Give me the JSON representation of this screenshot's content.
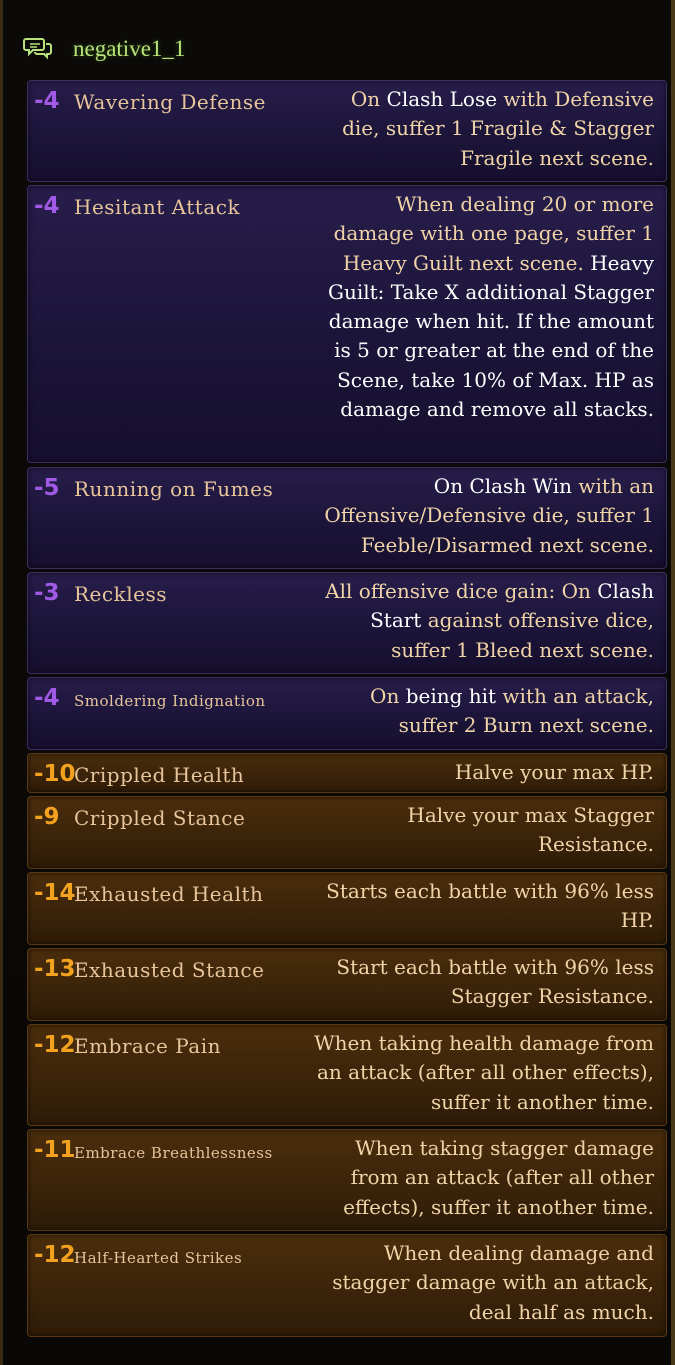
{
  "header": {
    "icon": "chat-bubbles-icon",
    "title": "negative1_1"
  },
  "colors": {
    "purple_cost": "#a05ae6",
    "orange_cost": "#f2a21e",
    "title": "#b8e27a",
    "desc": "#f0d4a8",
    "highlight": "#ffffff"
  },
  "passives": [
    {
      "cost": "-4",
      "name": "Wavering Defense",
      "theme": "purple",
      "small": false,
      "desc": [
        {
          "t": "On ",
          "w": false
        },
        {
          "t": "Clash Lose",
          "w": true
        },
        {
          "t": " with Defensive die, suffer 1 Fragile & Stagger Fragile next scene.",
          "w": false
        }
      ]
    },
    {
      "cost": "-4",
      "name": "Hesitant Attack",
      "theme": "purple",
      "small": false,
      "desc": [
        {
          "t": "When dealing 20 or more damage with one page, suffer 1 Heavy Guilt next scene. ",
          "w": false
        },
        {
          "t": "Heavy Guilt: Take X additional Stagger damage when hit. If the amount is 5 or greater at the end of the Scene, take 10% of Max. HP as damage and remove all stacks.",
          "w": true
        }
      ]
    },
    {
      "cost": "-5",
      "name": "Running on Fumes",
      "theme": "purple",
      "small": false,
      "desc": [
        {
          "t": "On Clash Win",
          "w": true
        },
        {
          "t": " with an Offensive/Defensive die, suffer 1 Feeble/Disarmed next scene.",
          "w": false
        }
      ]
    },
    {
      "cost": "-3",
      "name": "Reckless",
      "theme": "purple",
      "small": false,
      "desc": [
        {
          "t": "All offensive dice gain: On ",
          "w": false
        },
        {
          "t": "Clash Start",
          "w": true
        },
        {
          "t": " against offensive dice, suffer 1 Bleed next scene.",
          "w": false
        }
      ]
    },
    {
      "cost": "-4",
      "name": "Smoldering Indignation",
      "theme": "purple",
      "small": true,
      "desc": [
        {
          "t": "On ",
          "w": false
        },
        {
          "t": "being hit",
          "w": true
        },
        {
          "t": " with an attack, suffer 2 Burn next scene.",
          "w": false
        }
      ]
    },
    {
      "cost": "-10",
      "name": "Crippled Health",
      "theme": "orange",
      "small": false,
      "desc": [
        {
          "t": "Halve your max HP.",
          "w": false
        }
      ]
    },
    {
      "cost": "-9",
      "name": "Crippled Stance",
      "theme": "orange",
      "small": false,
      "desc": [
        {
          "t": "Halve your max Stagger Resistance.",
          "w": false
        }
      ]
    },
    {
      "cost": "-14",
      "name": "Exhausted Health",
      "theme": "orange",
      "small": false,
      "desc": [
        {
          "t": "Starts each battle with 96% less HP.",
          "w": false
        }
      ]
    },
    {
      "cost": "-13",
      "name": "Exhausted Stance",
      "theme": "orange",
      "small": false,
      "desc": [
        {
          "t": "Start each battle with 96% less Stagger Resistance.",
          "w": false
        }
      ]
    },
    {
      "cost": "-12",
      "name": "Embrace Pain",
      "theme": "orange",
      "small": false,
      "desc": [
        {
          "t": "When taking health damage from an attack (after all other effects), suffer it another time.",
          "w": false
        }
      ]
    },
    {
      "cost": "-11",
      "name": "Embrace Breathlessness",
      "theme": "orange",
      "small": true,
      "desc": [
        {
          "t": "When taking stagger damage from an attack (after all other effects), suffer it another time.",
          "w": false
        }
      ]
    },
    {
      "cost": "-12",
      "name": "Half-Hearted Strikes",
      "theme": "orange",
      "small": true,
      "desc": [
        {
          "t": "When dealing damage and stagger damage with an attack, deal half as much.",
          "w": false
        }
      ]
    }
  ]
}
